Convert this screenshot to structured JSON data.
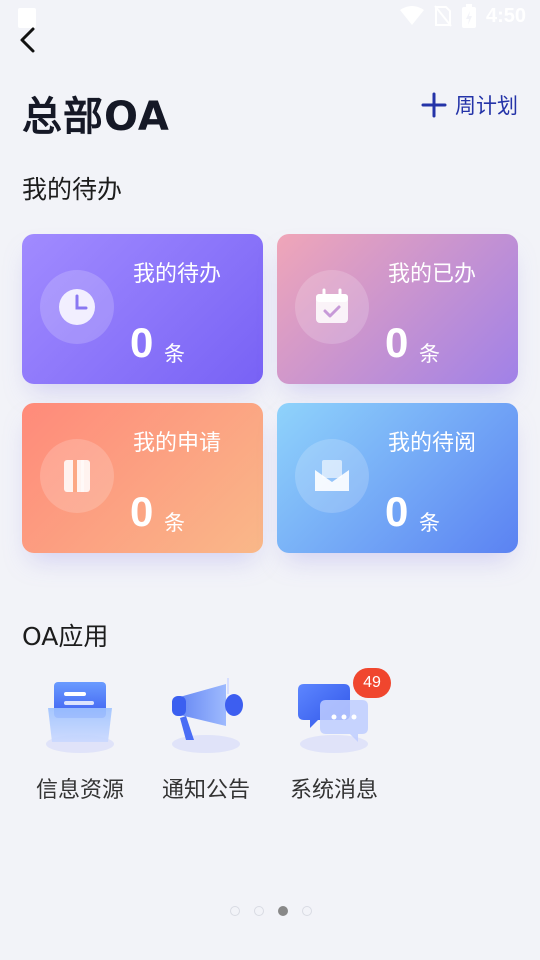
{
  "status_bar": {
    "time": "4:50"
  },
  "header": {
    "title": "总部OA",
    "weekly_plan_label": "周计划"
  },
  "todo_section": {
    "title": "我的待办",
    "cards": [
      {
        "label": "我的待办",
        "count": "0",
        "unit": "条",
        "icon": "clock-icon",
        "colors": [
          "#a18bff",
          "#7862f5"
        ]
      },
      {
        "label": "我的已办",
        "count": "0",
        "unit": "条",
        "icon": "calendar-check-icon",
        "colors": [
          "#f0a6b8",
          "#a081e8"
        ]
      },
      {
        "label": "我的申请",
        "count": "0",
        "unit": "条",
        "icon": "book-icon",
        "colors": [
          "#ff8a7a",
          "#f9b889"
        ]
      },
      {
        "label": "我的待阅",
        "count": "0",
        "unit": "条",
        "icon": "mail-icon",
        "colors": [
          "#8fd3fb",
          "#5b82f2"
        ]
      }
    ]
  },
  "apps_section": {
    "title": "OA应用",
    "apps": [
      {
        "label": "信息资源",
        "icon": "folder-info-icon"
      },
      {
        "label": "通知公告",
        "icon": "megaphone-icon"
      },
      {
        "label": "系统消息",
        "icon": "chat-bubble-icon",
        "badge": "49"
      }
    ]
  },
  "pager": {
    "total": 4,
    "active": 3
  }
}
